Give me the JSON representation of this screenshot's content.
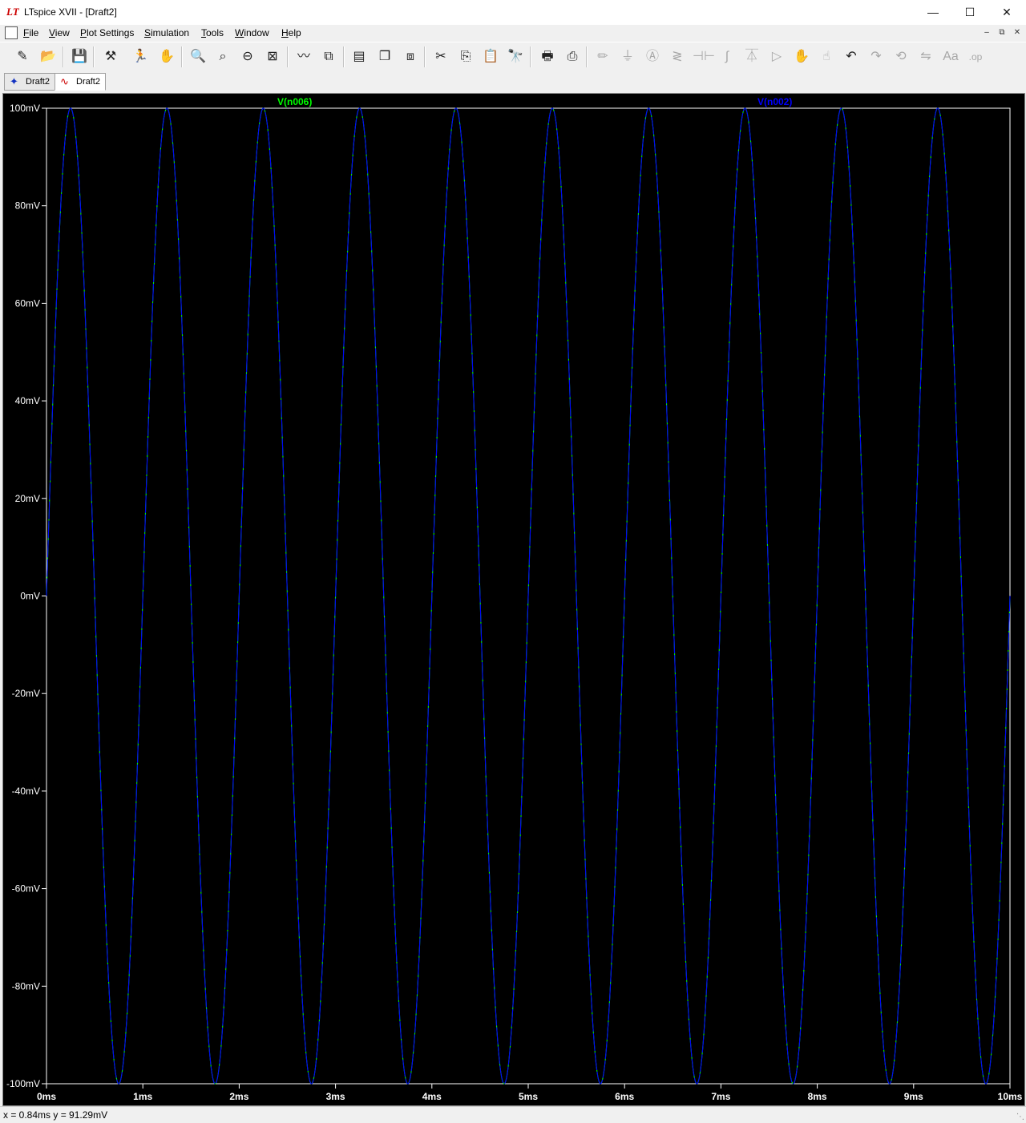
{
  "window": {
    "title": "LTspice XVII - [Draft2]"
  },
  "menu": {
    "items": [
      {
        "label": "File",
        "key": "F"
      },
      {
        "label": "View",
        "key": "V"
      },
      {
        "label": "Plot Settings",
        "key": "P"
      },
      {
        "label": "Simulation",
        "key": "S"
      },
      {
        "label": "Tools",
        "key": "T"
      },
      {
        "label": "Window",
        "key": "W"
      },
      {
        "label": "Help",
        "key": "H"
      }
    ]
  },
  "toolbar": {
    "buttons": [
      {
        "name": "new-schematic-icon",
        "glyph": "✎",
        "enabled": true
      },
      {
        "name": "open-icon",
        "glyph": "📂",
        "enabled": true
      },
      {
        "name": "save-icon",
        "glyph": "💾",
        "enabled": true
      },
      {
        "name": "control-panel-icon",
        "glyph": "⚒",
        "enabled": true
      },
      {
        "name": "run-icon",
        "glyph": "🏃",
        "enabled": true
      },
      {
        "name": "halt-icon",
        "glyph": "✋",
        "enabled": true
      },
      {
        "name": "zoom-in-icon",
        "glyph": "🔍",
        "enabled": true
      },
      {
        "name": "zoom-area-icon",
        "glyph": "⌕",
        "enabled": true
      },
      {
        "name": "zoom-out-icon",
        "glyph": "⊖",
        "enabled": true
      },
      {
        "name": "zoom-full-icon",
        "glyph": "⊠",
        "enabled": true
      },
      {
        "name": "autorange-icon",
        "glyph": "〰",
        "enabled": true
      },
      {
        "name": "add-trace-icon",
        "glyph": "⧉",
        "enabled": true
      },
      {
        "name": "tile-horizontal-icon",
        "glyph": "▤",
        "enabled": true
      },
      {
        "name": "cascade-icon",
        "glyph": "❐",
        "enabled": true
      },
      {
        "name": "tile-vertical-icon",
        "glyph": "⧈",
        "enabled": true
      },
      {
        "name": "cut-icon",
        "glyph": "✂",
        "enabled": true
      },
      {
        "name": "copy-icon",
        "glyph": "⎘",
        "enabled": true
      },
      {
        "name": "paste-icon",
        "glyph": "📋",
        "enabled": true
      },
      {
        "name": "find-icon",
        "glyph": "🔭",
        "enabled": true
      },
      {
        "name": "print-preview-icon",
        "glyph": "🖶",
        "enabled": true
      },
      {
        "name": "print-icon",
        "glyph": "⎙",
        "enabled": true
      },
      {
        "name": "draw-wire-icon",
        "glyph": "✏",
        "enabled": false
      },
      {
        "name": "ground-icon",
        "glyph": "⏚",
        "enabled": false
      },
      {
        "name": "label-net-icon",
        "glyph": "Ⓐ",
        "enabled": false
      },
      {
        "name": "resistor-icon",
        "glyph": "≷",
        "enabled": false
      },
      {
        "name": "capacitor-icon",
        "glyph": "⊣⊢",
        "enabled": false
      },
      {
        "name": "inductor-icon",
        "glyph": "∫",
        "enabled": false
      },
      {
        "name": "diode-icon",
        "glyph": "⏄",
        "enabled": false
      },
      {
        "name": "component-icon",
        "glyph": "▷",
        "enabled": false
      },
      {
        "name": "move-icon",
        "glyph": "✋",
        "enabled": false
      },
      {
        "name": "drag-icon",
        "glyph": "☝",
        "enabled": false
      },
      {
        "name": "undo-icon",
        "glyph": "↶",
        "enabled": true
      },
      {
        "name": "redo-icon",
        "glyph": "↷",
        "enabled": false
      },
      {
        "name": "rotate-icon",
        "glyph": "⟲",
        "enabled": false
      },
      {
        "name": "mirror-icon",
        "glyph": "⇋",
        "enabled": false
      },
      {
        "name": "text-icon",
        "glyph": "Aa",
        "enabled": false
      },
      {
        "name": "spice-directive-icon",
        "glyph": ".op",
        "enabled": false
      }
    ]
  },
  "tabs": [
    {
      "label": "Draft2",
      "kind": "schematic",
      "active": false
    },
    {
      "label": "Draft2",
      "kind": "waveform",
      "active": true
    }
  ],
  "status": {
    "text": "x = 0.84ms   y = 91.29mV"
  },
  "colors": {
    "plot_background": "#000000",
    "axis": "#ffffff",
    "trace_v006": "#00ff00",
    "trace_v002": "#0000ff"
  },
  "chart_data": {
    "type": "line",
    "title": "",
    "xlabel": "",
    "ylabel": "",
    "x_ticks": [
      "0ms",
      "1ms",
      "2ms",
      "3ms",
      "4ms",
      "5ms",
      "6ms",
      "7ms",
      "8ms",
      "9ms",
      "10ms"
    ],
    "y_ticks": [
      "100mV",
      "80mV",
      "60mV",
      "40mV",
      "20mV",
      "0mV",
      "-20mV",
      "-40mV",
      "-60mV",
      "-80mV",
      "-100mV"
    ],
    "xlim": [
      0,
      10
    ],
    "ylim": [
      -100,
      100
    ],
    "x_unit": "ms",
    "y_unit": "mV",
    "grid": false,
    "series": [
      {
        "name": "V(n006)",
        "color": "#00ff00",
        "function": "sine",
        "amplitude": 100,
        "frequency_khz": 1,
        "phase_deg": 0,
        "offset": 0
      },
      {
        "name": "V(n002)",
        "color": "#0000ff",
        "function": "sine",
        "amplitude": 100,
        "frequency_khz": 1,
        "phase_deg": 0,
        "offset": 0
      }
    ]
  }
}
